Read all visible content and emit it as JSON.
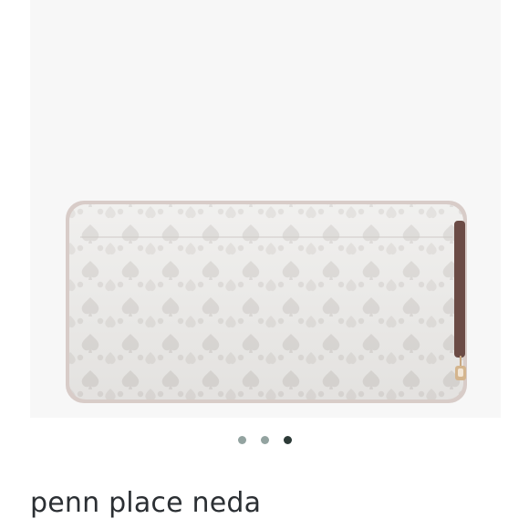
{
  "product": {
    "title": "penn place neda",
    "image_alt_icon": "wallet-image",
    "colors": {
      "wallet_base": "#e9e7e5",
      "pattern": "#d3d0cd",
      "zipper_trim": "#cfc3be",
      "pull_tab": "#6b4b45",
      "background": "#f7f7f7"
    }
  },
  "carousel": {
    "total": 3,
    "active_index": 2,
    "inactive_color": "#93a3a0",
    "active_color": "#2c3a37"
  }
}
